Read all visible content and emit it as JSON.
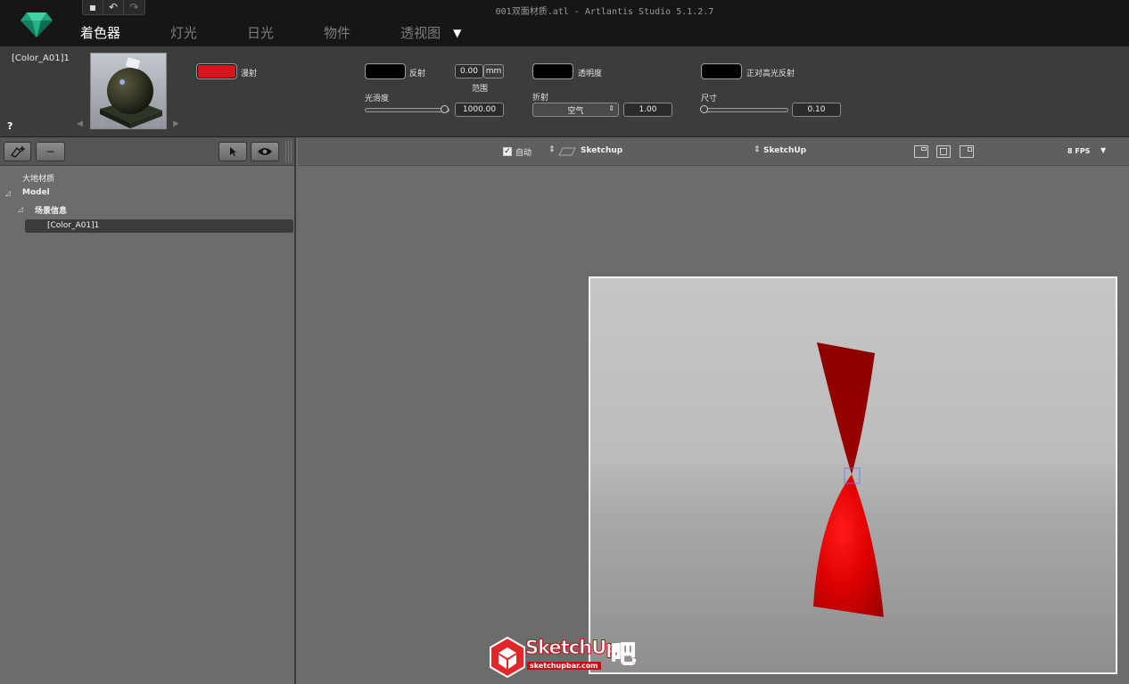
{
  "app": {
    "window_title": "001双面材质.atl - Artlantis Studio 5.1.2.7"
  },
  "tabs": [
    {
      "label": "着色器",
      "active": true
    },
    {
      "label": "灯光",
      "active": false
    },
    {
      "label": "日光",
      "active": false
    },
    {
      "label": "物件",
      "active": false
    },
    {
      "label": "透视图",
      "active": false
    }
  ],
  "quick_toolbar": {
    "icons": [
      "save-icon",
      "undo-icon",
      "redo-icon"
    ]
  },
  "material": {
    "name": "[Color_A01]1",
    "help": "?"
  },
  "params": {
    "diffuse_label": "漫射",
    "diffuse_color": "#d8141c",
    "reflection_label": "反射",
    "reflection_color": "#000000",
    "range_value": "0.00",
    "range_unit": "mm",
    "range_label": "范围",
    "gloss_label": "光滑度",
    "gloss_value": "1000.00",
    "gloss_fraction": 1.0,
    "transparency_label": "透明度",
    "transparency_color": "#000000",
    "refraction_label": "折射",
    "refraction_medium": "空气",
    "refraction_value": "1.00",
    "specular_label": "正对高光反射",
    "specular_color": "#000000",
    "size_label": "尺寸",
    "size_value": "0.10",
    "size_fraction": 0.0
  },
  "tree": {
    "toolbar": {
      "minus": "−"
    },
    "items": [
      {
        "label": "大地材质",
        "level": 0
      },
      {
        "label": "Model",
        "level": 0
      },
      {
        "label": "场景信息",
        "level": 1
      },
      {
        "label": "[Color_A01]1",
        "level": 2,
        "selected": true
      }
    ]
  },
  "viewport": {
    "auto_label": "自动",
    "auto_checked": true,
    "camera_source": "Sketchup",
    "scene_source": "SketchUp",
    "fps": "8 FPS"
  },
  "watermark": {
    "brand": "SketchUp",
    "suffix": "吧",
    "url": "sketchupbar.com"
  }
}
